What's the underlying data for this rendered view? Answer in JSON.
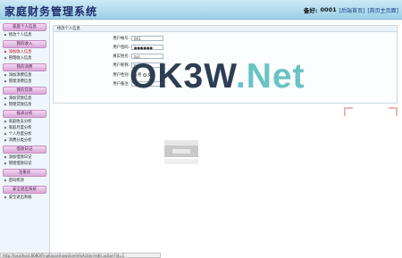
{
  "header": {
    "title": "家庭财务管理系统",
    "user_label": "备好:",
    "user_name": "0001",
    "link_home": "[后端首页]",
    "link_other": "[首页主页面]"
  },
  "sidebar": {
    "groups": [
      {
        "title": "家庭个人信息",
        "items": [
          {
            "label": "修改个人信息"
          }
        ]
      },
      {
        "title": "我的收入",
        "items": [
          {
            "label": "添加收入信息",
            "active": true
          },
          {
            "label": "管理收入信息"
          }
        ]
      },
      {
        "title": "我的消费",
        "items": [
          {
            "label": "添加消费信息"
          },
          {
            "label": "管理消费信息"
          }
        ]
      },
      {
        "title": "我的贷款",
        "items": [
          {
            "label": "添加贷款信息"
          },
          {
            "label": "管理贷款信息"
          }
        ]
      },
      {
        "title": "报表分析",
        "items": [
          {
            "label": "家庭收支分析"
          },
          {
            "label": "家庭月度分析"
          },
          {
            "label": "个人月度分析"
          },
          {
            "label": "消费分类分析"
          }
        ]
      },
      {
        "title": "借款日记",
        "items": [
          {
            "label": "添加借款日记"
          },
          {
            "label": "管理借款日记"
          }
        ]
      },
      {
        "title": "注册员",
        "items": [
          {
            "label": "密码修改"
          }
        ]
      },
      {
        "title": "安全退出系统",
        "items": [
          {
            "label": "安全退出系统"
          }
        ]
      }
    ]
  },
  "panel": {
    "title": "修改个人信息",
    "fields": {
      "account": {
        "label": "用户帐号:",
        "value": "001"
      },
      "password": {
        "label": "用户密码:",
        "value": "●●●●●●"
      },
      "name": {
        "label": "真实姓名:",
        "value": "zyz"
      },
      "nickname": {
        "label": "用户昵称:",
        "value": "hexpo"
      },
      "gender": {
        "label": "用户性别:",
        "option_male": "男",
        "option_female": "女"
      },
      "remark": {
        "label": "用户备注:"
      }
    }
  },
  "watermark": {
    "part1": "OK3W",
    "part2": ".Net"
  },
  "statusbar": {
    "url": "http://localhost:8080/FinalJava/showUserInfoAction!edit.action?id=1"
  }
}
